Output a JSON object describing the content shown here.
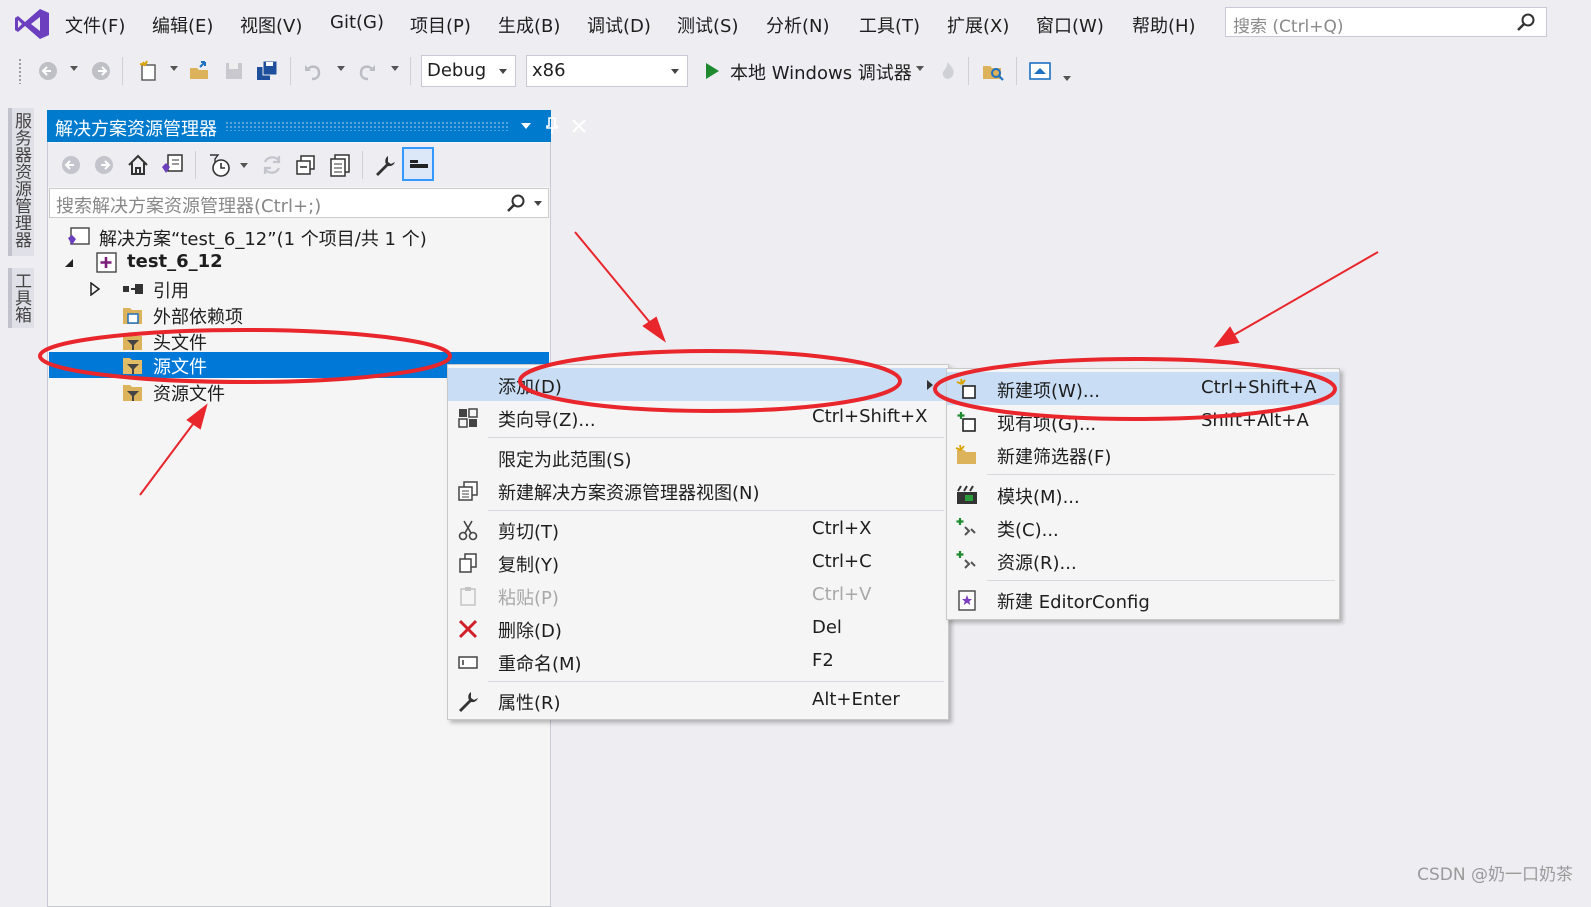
{
  "menubar": {
    "items": [
      "文件(F)",
      "编辑(E)",
      "视图(V)",
      "Git(G)",
      "项目(P)",
      "生成(B)",
      "调试(D)",
      "测试(S)",
      "分析(N)",
      "工具(T)",
      "扩展(X)",
      "窗口(W)",
      "帮助(H)"
    ],
    "search_placeholder": "搜索 (Ctrl+Q)"
  },
  "toolbar": {
    "config": "Debug",
    "platform": "x86",
    "run_label": "本地 Windows 调试器"
  },
  "side_tabs": [
    "服务器资源管理器",
    "工具箱"
  ],
  "solution_explorer": {
    "title": "解决方案资源管理器",
    "search_placeholder": "搜索解决方案资源管理器(Ctrl+;)",
    "tree": [
      {
        "label": "解决方案“test_6_12”(1 个项目/共 1 个)"
      },
      {
        "label": "test_6_12"
      },
      {
        "label": "引用"
      },
      {
        "label": "外部依赖项"
      },
      {
        "label": "头文件"
      },
      {
        "label": "源文件"
      },
      {
        "label": "资源文件"
      }
    ]
  },
  "context_menu": {
    "items": [
      {
        "label": "添加(D)",
        "shortcut": ""
      },
      {
        "label": "类向导(Z)...",
        "shortcut": "Ctrl+Shift+X"
      },
      {
        "label": "限定为此范围(S)",
        "shortcut": ""
      },
      {
        "label": "新建解决方案资源管理器视图(N)",
        "shortcut": ""
      },
      {
        "label": "剪切(T)",
        "shortcut": "Ctrl+X"
      },
      {
        "label": "复制(Y)",
        "shortcut": "Ctrl+C"
      },
      {
        "label": "粘贴(P)",
        "shortcut": "Ctrl+V"
      },
      {
        "label": "删除(D)",
        "shortcut": "Del"
      },
      {
        "label": "重命名(M)",
        "shortcut": "F2"
      },
      {
        "label": "属性(R)",
        "shortcut": "Alt+Enter"
      }
    ]
  },
  "submenu": {
    "items": [
      {
        "label": "新建项(W)...",
        "shortcut": "Ctrl+Shift+A"
      },
      {
        "label": "现有项(G)...",
        "shortcut": "Shift+Alt+A"
      },
      {
        "label": "新建筛选器(F)",
        "shortcut": ""
      },
      {
        "label": "模块(M)...",
        "shortcut": ""
      },
      {
        "label": "类(C)...",
        "shortcut": ""
      },
      {
        "label": "资源(R)...",
        "shortcut": ""
      },
      {
        "label": "新建 EditorConfig",
        "shortcut": ""
      }
    ]
  },
  "watermark": "CSDN @奶一口奶茶",
  "colors": {
    "accent": "#007acc",
    "selection": "#0078d7",
    "annotation": "#e8262c",
    "vs_purple": "#6c3fbf"
  }
}
